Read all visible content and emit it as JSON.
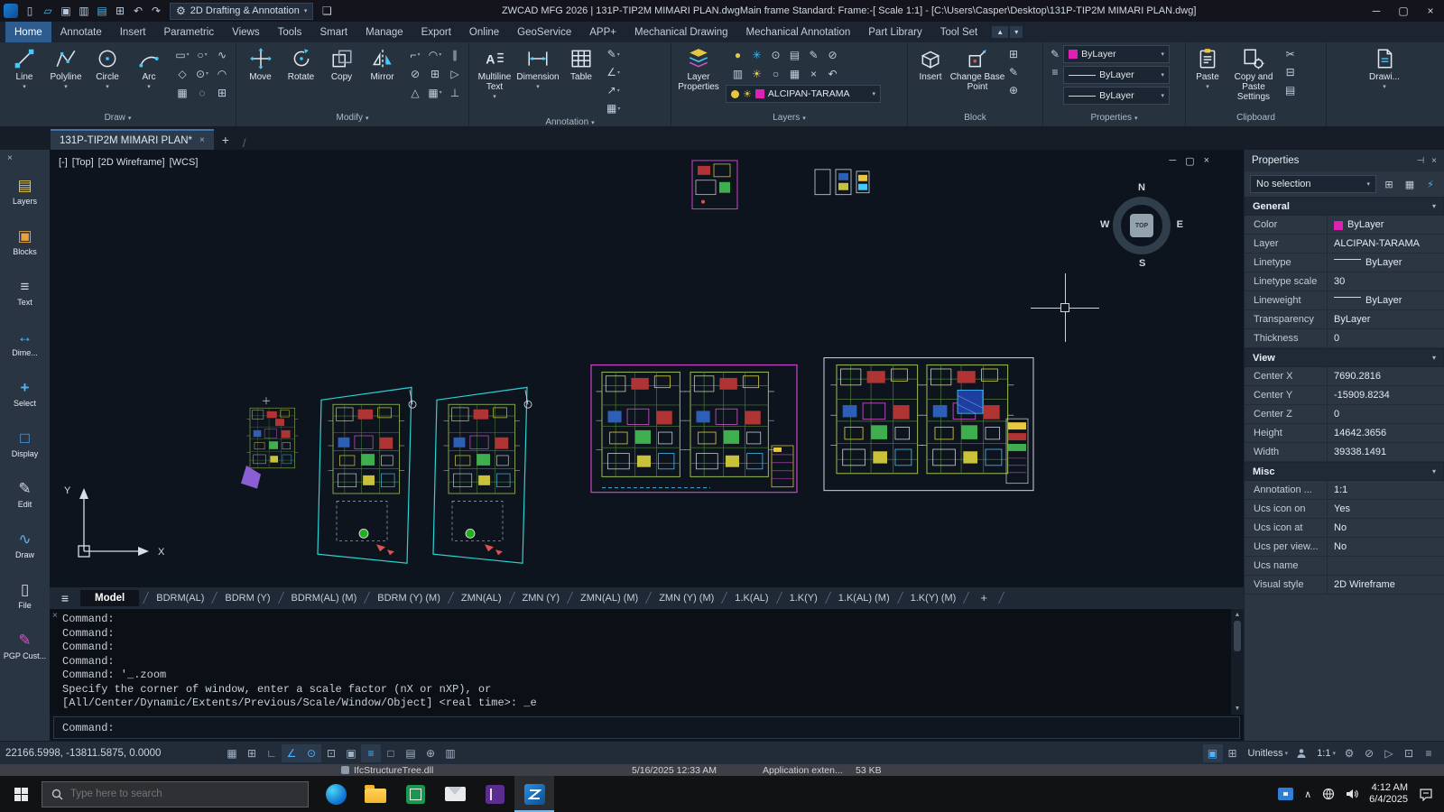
{
  "colors": {
    "accent_blue": "#2f5c8f",
    "magenta_swatch": "#e01fb4",
    "viewport_bg": "#0e141d",
    "taskbar_active_underline": "#76b9ed"
  },
  "title_bar": {
    "app_title": "ZWCAD MFG 2026 | 131P-TIP2M MIMARI PLAN.dwgMain frame  Standard: Frame:-[ Scale 1:1] - [C:\\Users\\Casper\\Desktop\\131P-TIP2M MIMARI PLAN.dwg]",
    "workspace": "2D Drafting & Annotation"
  },
  "ribbon_tabs": [
    "Home",
    "Annotate",
    "Insert",
    "Parametric",
    "Views",
    "Tools",
    "Smart",
    "Manage",
    "Export",
    "Online",
    "GeoService",
    "APP+",
    "Mechanical Drawing",
    "Mechanical Annotation",
    "Part Library",
    "Tool Set"
  ],
  "ribbon": {
    "draw": {
      "label": "Draw",
      "line": "Line",
      "polyline": "Polyline",
      "circle": "Circle",
      "arc": "Arc"
    },
    "modify": {
      "label": "Modify",
      "move": "Move",
      "rotate": "Rotate",
      "copy": "Copy",
      "mirror": "Mirror"
    },
    "annotation": {
      "label": "Annotation",
      "mtext": "Multiline Text",
      "dimension": "Dimension",
      "table": "Table"
    },
    "layers": {
      "label": "Layers",
      "layer_properties": "Layer Properties",
      "current_layer": "ALCIPAN-TARAMA"
    },
    "block": {
      "label": "Block",
      "insert": "Insert",
      "change_base_point": "Change Base Point"
    },
    "properties": {
      "label": "Properties",
      "color_value": "ByLayer",
      "lineweight_value": "ByLayer",
      "linetype_value": "ByLayer"
    },
    "clipboard": {
      "label": "Clipboard",
      "paste": "Paste",
      "copy_settings": "Copy and Paste Settings"
    },
    "drawing": {
      "label": "Drawi..."
    }
  },
  "doc_tabs": {
    "active_label": "131P-TIP2M MIMARI PLAN*",
    "add": "+"
  },
  "sidebar": {
    "items": [
      "Layers",
      "Blocks",
      "Text",
      "Dime...",
      "Select",
      "Display",
      "Edit",
      "Draw",
      "File",
      "PGP Cust..."
    ]
  },
  "viewport": {
    "controls": [
      "[-]",
      "[Top]",
      "[2D Wireframe]",
      "[WCS]"
    ],
    "compass": {
      "n": "N",
      "e": "E",
      "s": "S",
      "w": "W",
      "cube": "TOP"
    },
    "axes": {
      "x": "X",
      "y": "Y"
    }
  },
  "layout_tabs": {
    "model": "Model",
    "tabs": [
      "BDRM(AL)",
      "BDRM (Y)",
      "BDRM(AL) (M)",
      "BDRM (Y) (M)",
      "ZMN(AL)",
      "ZMN (Y)",
      "ZMN(AL) (M)",
      "ZMN (Y) (M)",
      "1.K(AL)",
      "1.K(Y)",
      "1.K(AL) (M)",
      "1.K(Y) (M)"
    ],
    "add": "+"
  },
  "command": {
    "history": [
      "Command:",
      "Command:",
      "Command:",
      "Command:",
      "Command: '_.zoom",
      "Specify the corner of window, enter a scale factor (nX or nXP), or",
      "[All/Center/Dynamic/Extents/Previous/Scale/Window/Object] <real time>: _e"
    ],
    "prompt": "Command:"
  },
  "properties_panel": {
    "title": "Properties",
    "selection": "No selection",
    "general": {
      "title": "General",
      "rows": [
        {
          "label": "Color",
          "value": "ByLayer",
          "swatch": "#e01fb4"
        },
        {
          "label": "Layer",
          "value": "ALCIPAN-TARAMA"
        },
        {
          "label": "Linetype",
          "value": "ByLayer"
        },
        {
          "label": "Linetype scale",
          "value": "30"
        },
        {
          "label": "Lineweight",
          "value": "ByLayer"
        },
        {
          "label": "Transparency",
          "value": "ByLayer"
        },
        {
          "label": "Thickness",
          "value": "0"
        }
      ]
    },
    "view": {
      "title": "View",
      "rows": [
        {
          "label": "Center X",
          "value": "7690.2816"
        },
        {
          "label": "Center Y",
          "value": "-15909.8234"
        },
        {
          "label": "Center Z",
          "value": "0"
        },
        {
          "label": "Height",
          "value": "14642.3656"
        },
        {
          "label": "Width",
          "value": "39338.1491"
        }
      ]
    },
    "misc": {
      "title": "Misc",
      "rows": [
        {
          "label": "Annotation ...",
          "value": "1:1"
        },
        {
          "label": "Ucs icon on",
          "value": "Yes"
        },
        {
          "label": "Ucs icon at",
          "value": "No"
        },
        {
          "label": "Ucs per view...",
          "value": "No"
        },
        {
          "label": "Ucs name",
          "value": ""
        },
        {
          "label": "Visual style",
          "value": "2D Wireframe"
        }
      ]
    }
  },
  "status_bar": {
    "coordinates": "22166.5998, -13811.5875, 0.0000",
    "units": "Unitless",
    "annotation_scale": "1:1"
  },
  "explorer_strip": {
    "file_name": "IfcStructureTree.dll",
    "date_modified": "5/16/2025 12:33 AM",
    "file_type": "Application exten...",
    "file_size": "53 KB"
  },
  "taskbar": {
    "search_placeholder": "Type here to search",
    "time": "4:12 AM",
    "date": "6/4/2025"
  }
}
